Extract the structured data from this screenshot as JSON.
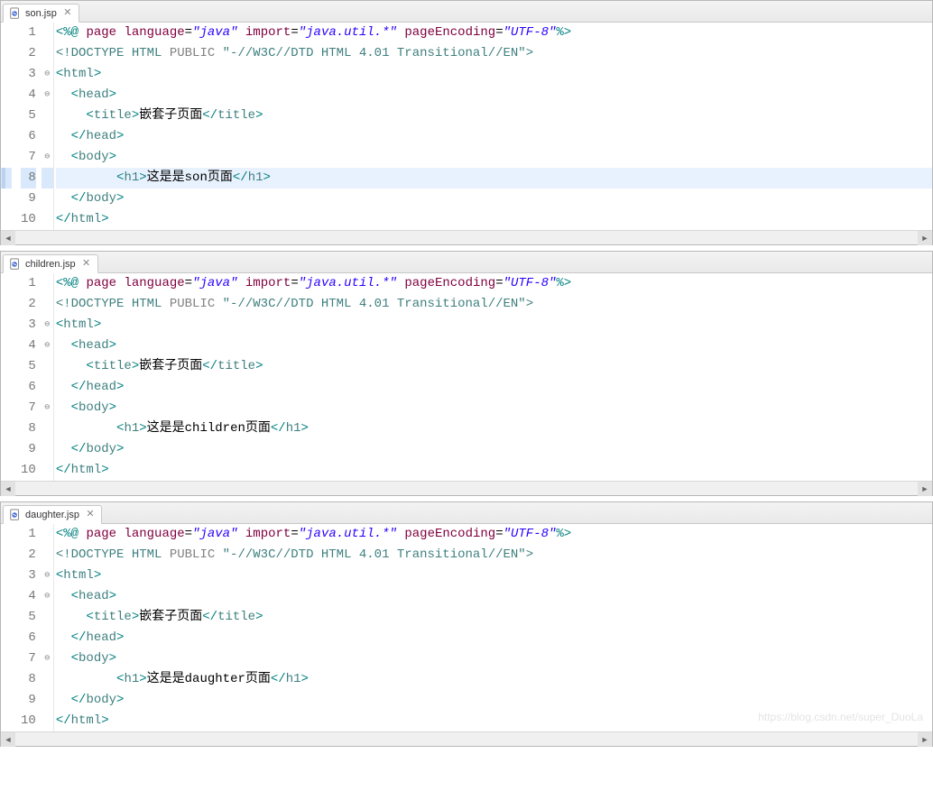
{
  "panels": [
    {
      "tabLabel": "son.jsp",
      "highlightLine": 8,
      "watermark": "",
      "lines": [
        {
          "n": 1,
          "fold": "",
          "tokens": [
            {
              "c": "tk-punc",
              "t": "<%@"
            },
            {
              "c": "tk-txt",
              "t": " "
            },
            {
              "c": "tk-dir",
              "t": "page"
            },
            {
              "c": "tk-txt",
              "t": " "
            },
            {
              "c": "tk-dir",
              "t": "language"
            },
            {
              "c": "tk-txt",
              "t": "="
            },
            {
              "c": "tk-str",
              "t": "\"java\""
            },
            {
              "c": "tk-txt",
              "t": " "
            },
            {
              "c": "tk-dir",
              "t": "import"
            },
            {
              "c": "tk-txt",
              "t": "="
            },
            {
              "c": "tk-str",
              "t": "\"java.util.*\""
            },
            {
              "c": "tk-txt",
              "t": " "
            },
            {
              "c": "tk-dir",
              "t": "pageEncoding"
            },
            {
              "c": "tk-txt",
              "t": "="
            },
            {
              "c": "tk-str",
              "t": "\"UTF-8\""
            },
            {
              "c": "tk-punc",
              "t": "%>"
            }
          ]
        },
        {
          "n": 2,
          "fold": "",
          "tokens": [
            {
              "c": "tk-doctype",
              "t": "<!DOCTYPE HTML "
            },
            {
              "c": "tk-docgray",
              "t": "PUBLIC "
            },
            {
              "c": "tk-doctype",
              "t": "\"-//W3C//DTD HTML 4.01 Transitional//EN\">"
            }
          ]
        },
        {
          "n": 3,
          "fold": "⊖",
          "tokens": [
            {
              "c": "tk-punc",
              "t": "<"
            },
            {
              "c": "tk-tag",
              "t": "html"
            },
            {
              "c": "tk-punc",
              "t": ">"
            }
          ]
        },
        {
          "n": 4,
          "fold": "⊖",
          "tokens": [
            {
              "c": "tk-txt",
              "t": "  "
            },
            {
              "c": "tk-punc",
              "t": "<"
            },
            {
              "c": "tk-tag",
              "t": "head"
            },
            {
              "c": "tk-punc",
              "t": ">"
            }
          ]
        },
        {
          "n": 5,
          "fold": "",
          "tokens": [
            {
              "c": "tk-txt",
              "t": "    "
            },
            {
              "c": "tk-punc",
              "t": "<"
            },
            {
              "c": "tk-tag",
              "t": "title"
            },
            {
              "c": "tk-punc",
              "t": ">"
            },
            {
              "c": "tk-txt",
              "t": "嵌套子页面"
            },
            {
              "c": "tk-punc",
              "t": "</"
            },
            {
              "c": "tk-tag",
              "t": "title"
            },
            {
              "c": "tk-punc",
              "t": ">"
            }
          ]
        },
        {
          "n": 6,
          "fold": "",
          "tokens": [
            {
              "c": "tk-txt",
              "t": "  "
            },
            {
              "c": "tk-punc",
              "t": "</"
            },
            {
              "c": "tk-tag",
              "t": "head"
            },
            {
              "c": "tk-punc",
              "t": ">"
            }
          ]
        },
        {
          "n": 7,
          "fold": "⊖",
          "tokens": [
            {
              "c": "tk-txt",
              "t": "  "
            },
            {
              "c": "tk-punc",
              "t": "<"
            },
            {
              "c": "tk-tag",
              "t": "body"
            },
            {
              "c": "tk-punc",
              "t": ">"
            }
          ]
        },
        {
          "n": 8,
          "fold": "",
          "tokens": [
            {
              "c": "tk-txt",
              "t": "        "
            },
            {
              "c": "tk-punc",
              "t": "<"
            },
            {
              "c": "tk-tag",
              "t": "h1"
            },
            {
              "c": "tk-punc",
              "t": ">"
            },
            {
              "c": "tk-txt",
              "t": "这是是son页面"
            },
            {
              "c": "tk-punc",
              "t": "</"
            },
            {
              "c": "tk-tag",
              "t": "h1"
            },
            {
              "c": "tk-punc",
              "t": ">"
            }
          ]
        },
        {
          "n": 9,
          "fold": "",
          "tokens": [
            {
              "c": "tk-txt",
              "t": "  "
            },
            {
              "c": "tk-punc",
              "t": "</"
            },
            {
              "c": "tk-tag",
              "t": "body"
            },
            {
              "c": "tk-punc",
              "t": ">"
            }
          ]
        },
        {
          "n": 10,
          "fold": "",
          "tokens": [
            {
              "c": "tk-punc",
              "t": "</"
            },
            {
              "c": "tk-tag",
              "t": "html"
            },
            {
              "c": "tk-punc",
              "t": ">"
            }
          ]
        }
      ]
    },
    {
      "tabLabel": "children.jsp",
      "highlightLine": 0,
      "watermark": "",
      "lines": [
        {
          "n": 1,
          "fold": "",
          "tokens": [
            {
              "c": "tk-punc",
              "t": "<%@"
            },
            {
              "c": "tk-txt",
              "t": " "
            },
            {
              "c": "tk-dir",
              "t": "page"
            },
            {
              "c": "tk-txt",
              "t": " "
            },
            {
              "c": "tk-dir",
              "t": "language"
            },
            {
              "c": "tk-txt",
              "t": "="
            },
            {
              "c": "tk-str",
              "t": "\"java\""
            },
            {
              "c": "tk-txt",
              "t": " "
            },
            {
              "c": "tk-dir",
              "t": "import"
            },
            {
              "c": "tk-txt",
              "t": "="
            },
            {
              "c": "tk-str",
              "t": "\"java.util.*\""
            },
            {
              "c": "tk-txt",
              "t": " "
            },
            {
              "c": "tk-dir",
              "t": "pageEncoding"
            },
            {
              "c": "tk-txt",
              "t": "="
            },
            {
              "c": "tk-str",
              "t": "\"UTF-8\""
            },
            {
              "c": "tk-punc",
              "t": "%>"
            }
          ]
        },
        {
          "n": 2,
          "fold": "",
          "tokens": [
            {
              "c": "tk-doctype",
              "t": "<!DOCTYPE HTML "
            },
            {
              "c": "tk-docgray",
              "t": "PUBLIC "
            },
            {
              "c": "tk-doctype",
              "t": "\"-//W3C//DTD HTML 4.01 Transitional//EN\">"
            }
          ]
        },
        {
          "n": 3,
          "fold": "⊖",
          "tokens": [
            {
              "c": "tk-punc",
              "t": "<"
            },
            {
              "c": "tk-tag",
              "t": "html"
            },
            {
              "c": "tk-punc",
              "t": ">"
            }
          ]
        },
        {
          "n": 4,
          "fold": "⊖",
          "tokens": [
            {
              "c": "tk-txt",
              "t": "  "
            },
            {
              "c": "tk-punc",
              "t": "<"
            },
            {
              "c": "tk-tag",
              "t": "head"
            },
            {
              "c": "tk-punc",
              "t": ">"
            }
          ]
        },
        {
          "n": 5,
          "fold": "",
          "tokens": [
            {
              "c": "tk-txt",
              "t": "    "
            },
            {
              "c": "tk-punc",
              "t": "<"
            },
            {
              "c": "tk-tag",
              "t": "title"
            },
            {
              "c": "tk-punc",
              "t": ">"
            },
            {
              "c": "tk-txt",
              "t": "嵌套子页面"
            },
            {
              "c": "tk-punc",
              "t": "</"
            },
            {
              "c": "tk-tag",
              "t": "title"
            },
            {
              "c": "tk-punc",
              "t": ">"
            }
          ]
        },
        {
          "n": 6,
          "fold": "",
          "tokens": [
            {
              "c": "tk-txt",
              "t": "  "
            },
            {
              "c": "tk-punc",
              "t": "</"
            },
            {
              "c": "tk-tag",
              "t": "head"
            },
            {
              "c": "tk-punc",
              "t": ">"
            }
          ]
        },
        {
          "n": 7,
          "fold": "⊖",
          "tokens": [
            {
              "c": "tk-txt",
              "t": "  "
            },
            {
              "c": "tk-punc",
              "t": "<"
            },
            {
              "c": "tk-tag",
              "t": "body"
            },
            {
              "c": "tk-punc",
              "t": ">"
            }
          ]
        },
        {
          "n": 8,
          "fold": "",
          "tokens": [
            {
              "c": "tk-txt",
              "t": "        "
            },
            {
              "c": "tk-punc",
              "t": "<"
            },
            {
              "c": "tk-tag",
              "t": "h1"
            },
            {
              "c": "tk-punc",
              "t": ">"
            },
            {
              "c": "tk-txt",
              "t": "这是是children页面"
            },
            {
              "c": "tk-punc",
              "t": "</"
            },
            {
              "c": "tk-tag",
              "t": "h1"
            },
            {
              "c": "tk-punc",
              "t": ">"
            }
          ]
        },
        {
          "n": 9,
          "fold": "",
          "tokens": [
            {
              "c": "tk-txt",
              "t": "  "
            },
            {
              "c": "tk-punc",
              "t": "</"
            },
            {
              "c": "tk-tag",
              "t": "body"
            },
            {
              "c": "tk-punc",
              "t": ">"
            }
          ]
        },
        {
          "n": 10,
          "fold": "",
          "tokens": [
            {
              "c": "tk-punc",
              "t": "</"
            },
            {
              "c": "tk-tag",
              "t": "html"
            },
            {
              "c": "tk-punc",
              "t": ">"
            }
          ]
        }
      ]
    },
    {
      "tabLabel": "daughter.jsp",
      "highlightLine": 0,
      "watermark": "https://blog.csdn.net/super_DuoLa",
      "lines": [
        {
          "n": 1,
          "fold": "",
          "tokens": [
            {
              "c": "tk-punc",
              "t": "<%@"
            },
            {
              "c": "tk-txt",
              "t": " "
            },
            {
              "c": "tk-dir",
              "t": "page"
            },
            {
              "c": "tk-txt",
              "t": " "
            },
            {
              "c": "tk-dir",
              "t": "language"
            },
            {
              "c": "tk-txt",
              "t": "="
            },
            {
              "c": "tk-str",
              "t": "\"java\""
            },
            {
              "c": "tk-txt",
              "t": " "
            },
            {
              "c": "tk-dir",
              "t": "import"
            },
            {
              "c": "tk-txt",
              "t": "="
            },
            {
              "c": "tk-str",
              "t": "\"java.util.*\""
            },
            {
              "c": "tk-txt",
              "t": " "
            },
            {
              "c": "tk-dir",
              "t": "pageEncoding"
            },
            {
              "c": "tk-txt",
              "t": "="
            },
            {
              "c": "tk-str",
              "t": "\"UTF-8\""
            },
            {
              "c": "tk-punc",
              "t": "%>"
            }
          ]
        },
        {
          "n": 2,
          "fold": "",
          "tokens": [
            {
              "c": "tk-doctype",
              "t": "<!DOCTYPE HTML "
            },
            {
              "c": "tk-docgray",
              "t": "PUBLIC "
            },
            {
              "c": "tk-doctype",
              "t": "\"-//W3C//DTD HTML 4.01 Transitional//EN\">"
            }
          ]
        },
        {
          "n": 3,
          "fold": "⊖",
          "tokens": [
            {
              "c": "tk-punc",
              "t": "<"
            },
            {
              "c": "tk-tag",
              "t": "html"
            },
            {
              "c": "tk-punc",
              "t": ">"
            }
          ]
        },
        {
          "n": 4,
          "fold": "⊖",
          "tokens": [
            {
              "c": "tk-txt",
              "t": "  "
            },
            {
              "c": "tk-punc",
              "t": "<"
            },
            {
              "c": "tk-tag",
              "t": "head"
            },
            {
              "c": "tk-punc",
              "t": ">"
            }
          ]
        },
        {
          "n": 5,
          "fold": "",
          "tokens": [
            {
              "c": "tk-txt",
              "t": "    "
            },
            {
              "c": "tk-punc",
              "t": "<"
            },
            {
              "c": "tk-tag",
              "t": "title"
            },
            {
              "c": "tk-punc",
              "t": ">"
            },
            {
              "c": "tk-txt",
              "t": "嵌套子页面"
            },
            {
              "c": "tk-punc",
              "t": "</"
            },
            {
              "c": "tk-tag",
              "t": "title"
            },
            {
              "c": "tk-punc",
              "t": ">"
            }
          ]
        },
        {
          "n": 6,
          "fold": "",
          "tokens": [
            {
              "c": "tk-txt",
              "t": "  "
            },
            {
              "c": "tk-punc",
              "t": "</"
            },
            {
              "c": "tk-tag",
              "t": "head"
            },
            {
              "c": "tk-punc",
              "t": ">"
            }
          ]
        },
        {
          "n": 7,
          "fold": "⊖",
          "tokens": [
            {
              "c": "tk-txt",
              "t": "  "
            },
            {
              "c": "tk-punc",
              "t": "<"
            },
            {
              "c": "tk-tag",
              "t": "body"
            },
            {
              "c": "tk-punc",
              "t": ">"
            }
          ]
        },
        {
          "n": 8,
          "fold": "",
          "tokens": [
            {
              "c": "tk-txt",
              "t": "        "
            },
            {
              "c": "tk-punc",
              "t": "<"
            },
            {
              "c": "tk-tag",
              "t": "h1"
            },
            {
              "c": "tk-punc",
              "t": ">"
            },
            {
              "c": "tk-txt",
              "t": "这是是daughter页面"
            },
            {
              "c": "tk-punc",
              "t": "</"
            },
            {
              "c": "tk-tag",
              "t": "h1"
            },
            {
              "c": "tk-punc",
              "t": ">"
            }
          ]
        },
        {
          "n": 9,
          "fold": "",
          "tokens": [
            {
              "c": "tk-txt",
              "t": "  "
            },
            {
              "c": "tk-punc",
              "t": "</"
            },
            {
              "c": "tk-tag",
              "t": "body"
            },
            {
              "c": "tk-punc",
              "t": ">"
            }
          ]
        },
        {
          "n": 10,
          "fold": "",
          "tokens": [
            {
              "c": "tk-punc",
              "t": "</"
            },
            {
              "c": "tk-tag",
              "t": "html"
            },
            {
              "c": "tk-punc",
              "t": ">"
            }
          ]
        }
      ]
    }
  ]
}
